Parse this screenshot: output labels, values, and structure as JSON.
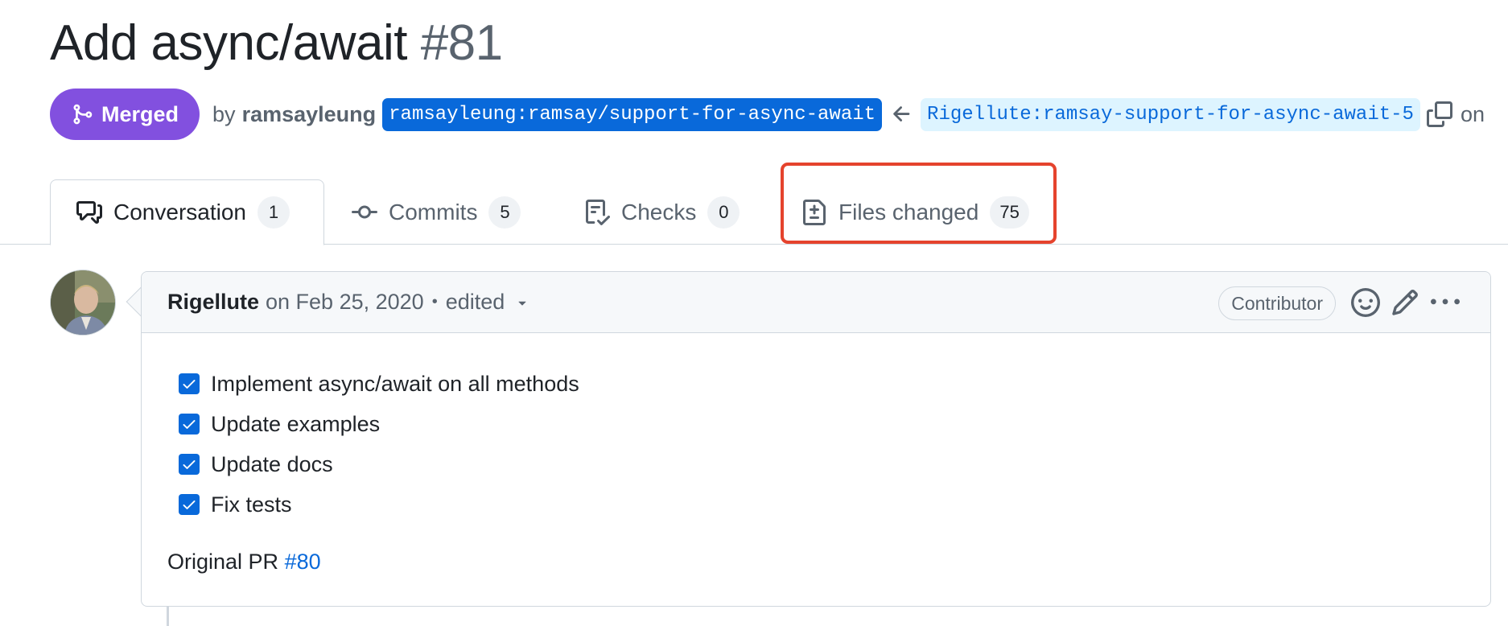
{
  "pr": {
    "title": "Add async/await",
    "number": "#81",
    "state": "Merged",
    "by_text": "by",
    "author": "ramsayleung",
    "base_branch": "ramsayleung:ramsay/support-for-async-await",
    "head_branch": "Rigellute:ramsay-support-for-async-await-5",
    "on_text": "on"
  },
  "tabs": [
    {
      "label": "Conversation",
      "count": "1",
      "icon": "comment-discussion-icon"
    },
    {
      "label": "Commits",
      "count": "5",
      "icon": "git-commit-icon"
    },
    {
      "label": "Checks",
      "count": "0",
      "icon": "checklist-icon"
    },
    {
      "label": "Files changed",
      "count": "75",
      "icon": "file-diff-icon"
    }
  ],
  "comment": {
    "author": "Rigellute",
    "date": "on Feb 25, 2020",
    "separator": "•",
    "edited": "edited",
    "role": "Contributor",
    "tasks": [
      {
        "label": "Implement async/await on all methods",
        "checked": true
      },
      {
        "label": "Update examples",
        "checked": true
      },
      {
        "label": "Update docs",
        "checked": true
      },
      {
        "label": "Fix tests",
        "checked": true
      }
    ],
    "original_pr_text": "Original PR",
    "original_pr_link": "#80"
  },
  "colors": {
    "merged": "#8250df",
    "link": "#0969da",
    "highlight": "#e5432d"
  }
}
